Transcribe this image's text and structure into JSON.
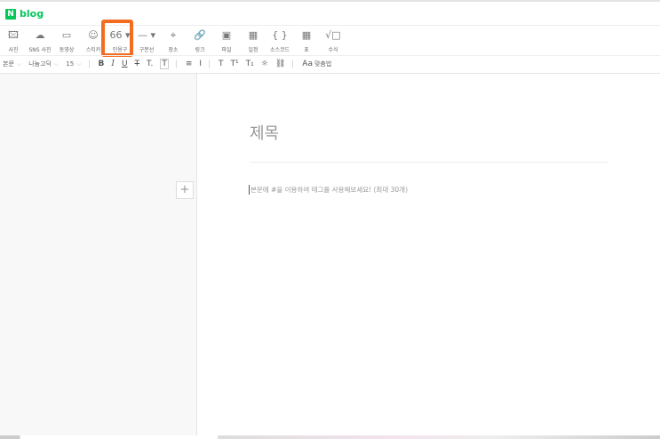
{
  "app": {
    "logo_letter": "N",
    "logo_text": "blog"
  },
  "toolbar": [
    {
      "icon": "🖾",
      "label": "사진"
    },
    {
      "icon": "☁",
      "label": "SNS 사진"
    },
    {
      "icon": "▭",
      "label": "동영상"
    },
    {
      "icon": "☺",
      "label": "스티커"
    },
    {
      "icon": "66 ▾",
      "label": "인용구"
    },
    {
      "icon": "— ▾",
      "label": "구분선"
    },
    {
      "icon": "⌖",
      "label": "장소"
    },
    {
      "icon": "🔗",
      "label": "링크"
    },
    {
      "icon": "▣",
      "label": "파일"
    },
    {
      "icon": "▦",
      "label": "일정"
    },
    {
      "icon": "{ }",
      "label": "소스코드"
    },
    {
      "icon": "▦",
      "label": "표"
    },
    {
      "icon": "√□",
      "label": "수식"
    }
  ],
  "format": {
    "style": "본문",
    "font": "나눔고딕",
    "size": "15",
    "spell": "맞춤법",
    "glyphs": [
      "B",
      "I",
      "U",
      "T",
      "T.",
      "T",
      "≡",
      "I",
      "T",
      "T¹",
      "T₁",
      "☼",
      "⛓",
      "Aa"
    ]
  },
  "editor": {
    "title_placeholder": "제목",
    "body_placeholder": "본문에 #을 이용하여 태그를 사용해보세요! (최대 30개)",
    "add_button": "+"
  }
}
